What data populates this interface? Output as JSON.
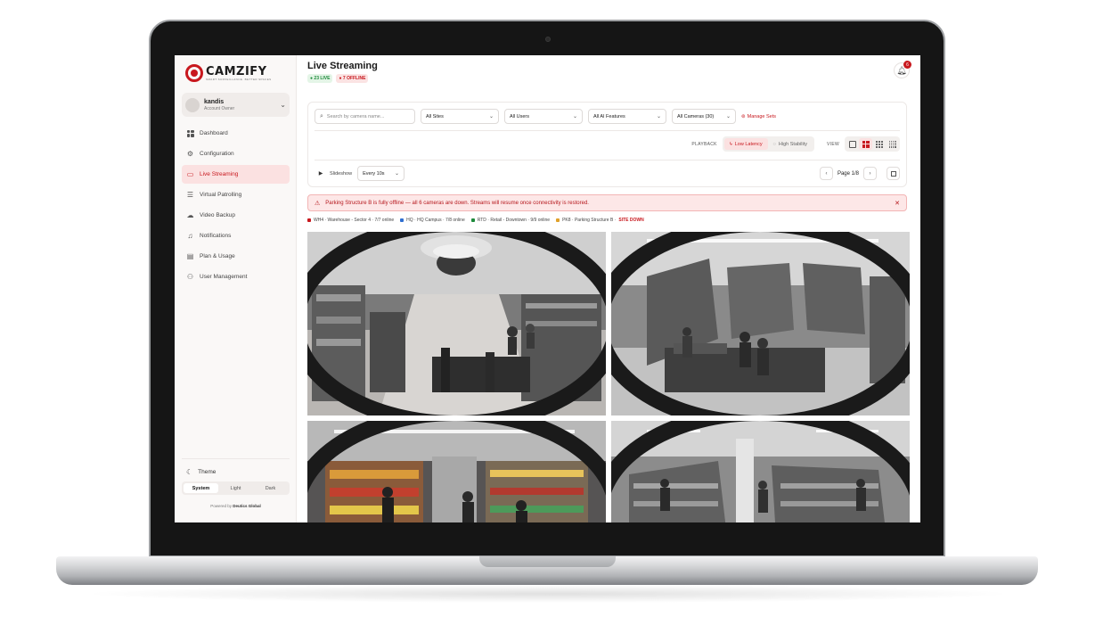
{
  "brand": {
    "name": "CAMZIFY",
    "tagline": "SMART SURVEILLANCE. BETTER SPACES"
  },
  "account": {
    "name": "kandis",
    "role": "Account Owner"
  },
  "nav": [
    {
      "label": "Dashboard",
      "icon": "dashboard-icon",
      "active": false
    },
    {
      "label": "Configuration",
      "icon": "gear-icon",
      "active": false
    },
    {
      "label": "Live Streaming",
      "icon": "video-icon",
      "active": true
    },
    {
      "label": "Virtual Patrolling",
      "icon": "patrol-icon",
      "active": false
    },
    {
      "label": "Video Backup",
      "icon": "cloud-icon",
      "active": false
    },
    {
      "label": "Notifications",
      "icon": "bell-icon",
      "active": false
    },
    {
      "label": "Plan & Usage",
      "icon": "document-icon",
      "active": false
    },
    {
      "label": "User Management",
      "icon": "users-icon",
      "active": false
    }
  ],
  "theme": {
    "label": "Theme",
    "options": [
      "System",
      "Light",
      "Dark"
    ],
    "selected": "System"
  },
  "powered_by": {
    "prefix": "Powered by",
    "company": "Deutics Global"
  },
  "header": {
    "title": "Live Streaming",
    "live_badge": "● 23 LIVE",
    "offline_badge": "● 7 OFFLINE",
    "notification_count": "6"
  },
  "filters": {
    "search_placeholder": "Search by camera name...",
    "sites": "All Sites",
    "users": "All Users",
    "ai_features": "All AI Features",
    "cameras": "All Cameras (30)",
    "manage_sets": "Manage Sets"
  },
  "playback": {
    "label": "PLAYBACK",
    "options": [
      "Low Latency",
      "High Stability"
    ],
    "selected": "Low Latency"
  },
  "view": {
    "label": "VIEW"
  },
  "slideshow": {
    "label": "Slideshow",
    "interval": "Every 10s"
  },
  "pager": {
    "text": "Page 1/8"
  },
  "alert": {
    "message": "Parking Structure B is fully offline — all 6 cameras are down. Streams will resume once connectivity is restored."
  },
  "sites": [
    {
      "text": "WH4 · Warehouse - Sector 4 · 7/7 online",
      "status": "",
      "color": "#c8181e"
    },
    {
      "text": "HQ · HQ Campus · 7/8 online",
      "status": "",
      "color": "#2f6fd1"
    },
    {
      "text": "RTD · Retail - Downtown · 9/9 online",
      "status": "",
      "color": "#1d8a3b"
    },
    {
      "text": "PK8 · Parking Structure B ·",
      "status": "SITE DOWN",
      "color": "#e0a12b"
    }
  ],
  "colors": {
    "accent": "#c8181e",
    "live": "#1d8a3b",
    "offline": "#c8181e"
  }
}
